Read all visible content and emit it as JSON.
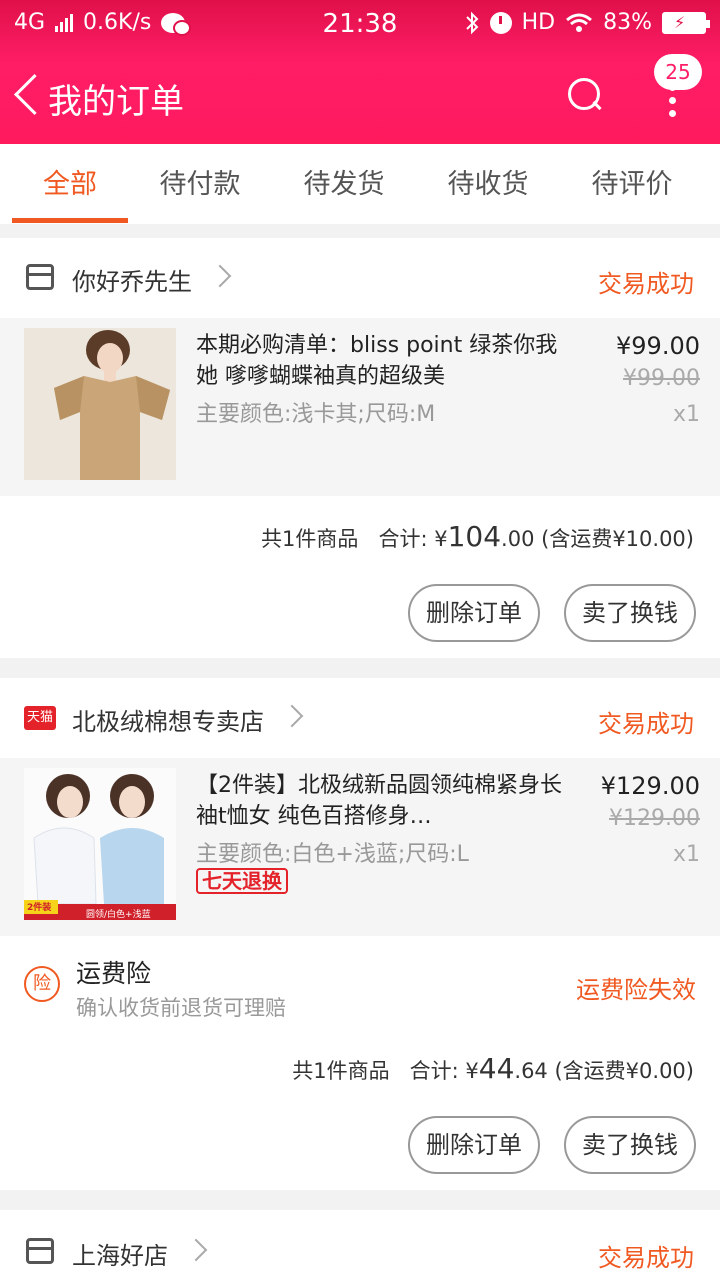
{
  "status_bar": {
    "network": "4G",
    "speed": "0.6K/s",
    "time": "21:38",
    "hd": "HD",
    "battery": "83%"
  },
  "header": {
    "title": "我的订单",
    "badge_count": "25"
  },
  "tabs": [
    {
      "label": "全部",
      "active": true
    },
    {
      "label": "待付款"
    },
    {
      "label": "待发货"
    },
    {
      "label": "待收货"
    },
    {
      "label": "待评价"
    }
  ],
  "orders": [
    {
      "shop": "你好乔先生",
      "status": "交易成功",
      "item": {
        "title": "本期必购清单：bliss point 绿茶你我她 嗲嗲蝴蝶袖真的超级美",
        "spec": "主要颜色:浅卡其;尺码:M",
        "price": "¥99.00",
        "orig_price": "¥99.00",
        "qty": "x1"
      },
      "summary": {
        "count": "共1件商品",
        "total_label": "合计: ¥",
        "total_int": "104",
        "total_dec": ".00",
        "shipping": "(含运费¥10.00)"
      },
      "buttons": [
        "删除订单",
        "卖了换钱"
      ]
    },
    {
      "shop": "北极绒棉想专卖店",
      "shop_badge": "天猫",
      "status": "交易成功",
      "item": {
        "title": "【2件装】北极绒新品圆领纯棉紧身长袖t恤女 纯色百搭修身…",
        "spec": "主要颜色:白色+浅蓝;尺码:L",
        "tag": "七天退换",
        "thumb_label": "2件装",
        "thumb_caption": "圆领/白色+浅蓝",
        "price": "¥129.00",
        "orig_price": "¥129.00",
        "qty": "x1"
      },
      "insurance": {
        "icon": "险",
        "title": "运费险",
        "subtitle": "确认收货前退货可理赔",
        "status": "运费险失效"
      },
      "summary": {
        "count": "共1件商品",
        "total_label": "合计: ¥",
        "total_int": "44",
        "total_dec": ".64",
        "shipping": "(含运费¥0.00)"
      },
      "buttons": [
        "删除订单",
        "卖了换钱"
      ]
    },
    {
      "shop": "上海好店",
      "status": "交易成功"
    }
  ],
  "colors": {
    "accent": "#f05a22",
    "brand": "#ff1d66",
    "tmall": "#e4222a"
  }
}
